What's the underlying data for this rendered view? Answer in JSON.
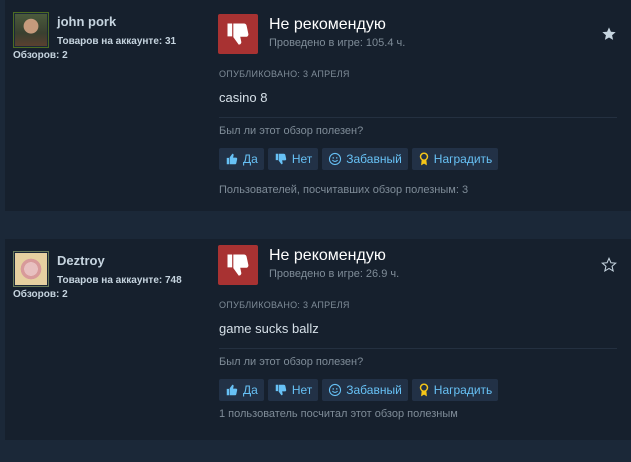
{
  "reviews": [
    {
      "author": "john pork",
      "products_owned": "Товаров на аккаунте: 31",
      "reviews_count": "Обзоров: 2",
      "verdict": "Не рекомендую",
      "playtime": "Проведено в игре: 105.4 ч.",
      "posted": "ОПУБЛИКОВАНО: 3 АПРЕЛЯ",
      "text": "casino 8",
      "question": "Был ли этот обзор полезен?",
      "btn_yes": "Да",
      "btn_no": "Нет",
      "btn_funny": "Забавный",
      "btn_award": "Наградить",
      "helpful": "Пользователей, посчитавших обзор полезным: 3",
      "star": "filled"
    },
    {
      "author": "Deztroy",
      "products_owned": "Товаров на аккаунте: 748",
      "reviews_count": "Обзоров: 2",
      "verdict": "Не рекомендую",
      "playtime": "Проведено в игре: 26.9 ч.",
      "posted": "ОПУБЛИКОВАНО: 3 АПРЕЛЯ",
      "text": "game sucks ballz",
      "question": "Был ли этот обзор полезен?",
      "btn_yes": "Да",
      "btn_no": "Нет",
      "btn_funny": "Забавный",
      "btn_award": "Наградить",
      "helpful": "1 пользователь посчитал этот обзор полезным",
      "star": "outline"
    }
  ],
  "colors": {
    "page_bg": "#1b2838",
    "card_bg": "#16202d",
    "thumbs_down_bg": "#a83232",
    "button_bg": "#223146",
    "button_text": "#67c1f5",
    "award_icon": "#f5c518"
  },
  "icons": {
    "thumbs_down": "thumbs-down-icon",
    "thumbs_up": "thumbs-up-icon",
    "smiley": "smiley-icon",
    "award": "award-ribbon-icon",
    "star": "star-icon"
  }
}
